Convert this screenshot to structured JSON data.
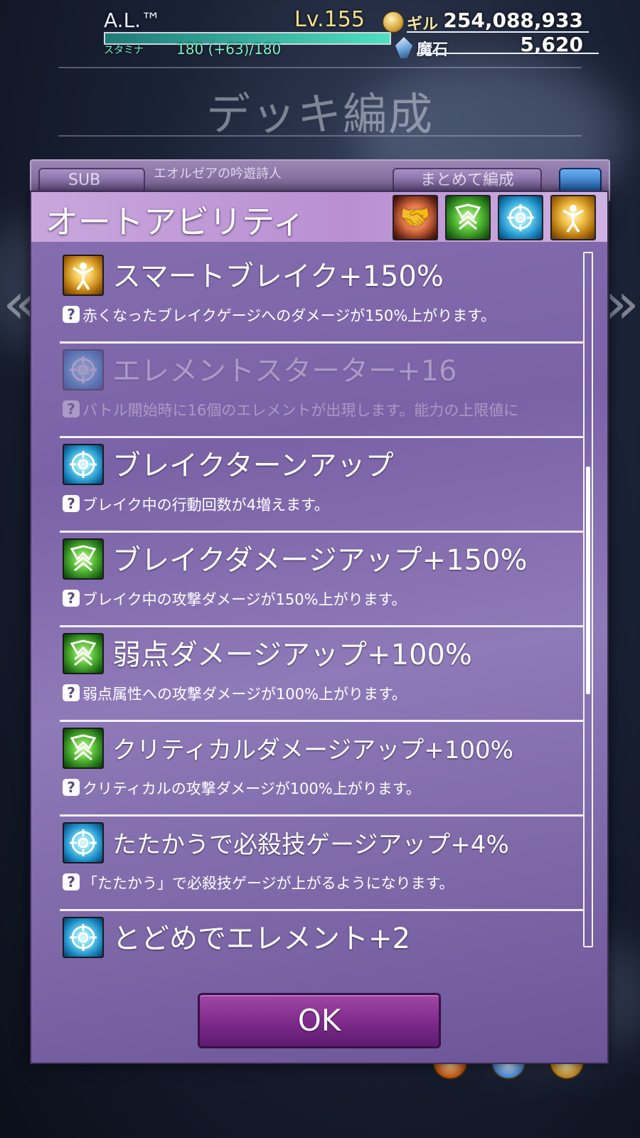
{
  "player": {
    "name": "A.L.™",
    "level": "Lv.155",
    "stamina_label": "スタミナ",
    "stamina_value": "180 (+63)/180",
    "stamina_fraction": 1.0
  },
  "currency": {
    "gil_label": "ギル",
    "gil_value": "254,088,933",
    "stone_label": "魔石",
    "stone_value": "5,620"
  },
  "page": {
    "title": "デッキ編成"
  },
  "deck": {
    "sub_label": "SUB",
    "character_name": "エオルゼアの吟遊詩人",
    "bulk_label": "まとめて編成"
  },
  "modal": {
    "title": "オートアビリティ",
    "header_icons": [
      "handshake-icon",
      "green-shield-icon",
      "blue-element-icon",
      "gold-figure-icon"
    ],
    "ok_label": "OK",
    "scroll_position": 0.35
  },
  "abilities": [
    {
      "name": "スマートブレイク+150%",
      "desc": "赤くなったブレイクゲージへのダメージが150%上がります。",
      "icon": "gold-figure-icon",
      "dimmed": false
    },
    {
      "name": "エレメントスターター+16",
      "desc": "バトル開始時に16個のエレメントが出現します。能力の上限値に",
      "icon": "blue-element-icon",
      "dimmed": true
    },
    {
      "name": "ブレイクターンアップ",
      "desc": "ブレイク中の行動回数が4増えます。",
      "icon": "blue-element-icon",
      "dimmed": false
    },
    {
      "name": "ブレイクダメージアップ+150%",
      "desc": "ブレイク中の攻撃ダメージが150%上がります。",
      "icon": "green-shield-icon",
      "dimmed": false
    },
    {
      "name": "弱点ダメージアップ+100%",
      "desc": "弱点属性への攻撃ダメージが100%上がります。",
      "icon": "green-shield-icon",
      "dimmed": false
    },
    {
      "name": "クリティカルダメージアップ+100%",
      "desc": "クリティカルの攻撃ダメージが100%上がります。",
      "icon": "green-shield-icon",
      "dimmed": false
    },
    {
      "name": "たたかうで必殺技ゲージアップ+4%",
      "desc": "「たたかう」で必殺技ゲージが上がるようになります。",
      "icon": "blue-element-icon",
      "dimmed": false
    },
    {
      "name": "とどめでエレメント+2",
      "desc": "",
      "icon": "blue-element-icon",
      "dimmed": false
    }
  ],
  "help_glyph": "?",
  "nav": {
    "left_arrow": "«",
    "right_arrow": "»"
  },
  "colors": {
    "modal_bg": "#7a62a6",
    "header_bg": "#c9a7dd",
    "ok_button": "#7c2a8a",
    "level_text": "#f2df8a",
    "stamina_text": "#7ff2c4"
  }
}
